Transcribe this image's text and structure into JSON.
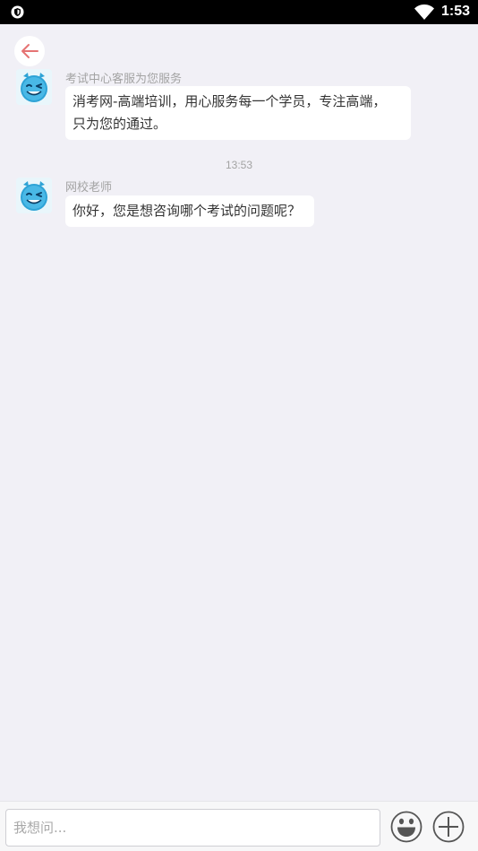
{
  "status_bar": {
    "time": "1:53",
    "icons": [
      "shield-icon",
      "wifi-icon"
    ]
  },
  "header": {
    "back_icon": "arrow-left-icon"
  },
  "messages": [
    {
      "sender": "考试中心客服为您服务",
      "line1": "消考网-高端培训，用心服务每一个学员，专注高端，",
      "line2": "只为您的通过。",
      "avatar_icon": "smiley-avatar-icon"
    },
    {
      "sender": "网校老师",
      "line1": "你好，您是想咨询哪个考试的问题呢？",
      "avatar_icon": "smiley-avatar-icon"
    }
  ],
  "time_divider": "13:53",
  "composer": {
    "placeholder": "我想问...",
    "value": "",
    "emoji_icon": "emoji-icon",
    "plus_icon": "plus-icon"
  },
  "colors": {
    "background": "#f1f0f6",
    "back_arrow": "#e57373",
    "avatar": "#2ea3d6"
  }
}
